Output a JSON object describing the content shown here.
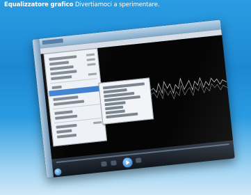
{
  "caption": {
    "line1_bold": "Equalizzatore grafico",
    "line1_text": "Divertiamoci a sperimentare."
  },
  "icons": {
    "start": "windows-orb-icon",
    "play": "play-icon",
    "previous": "previous-icon",
    "next": "next-icon",
    "stop": "stop-icon"
  },
  "colors": {
    "page_background": "#1f8ed6",
    "menu_highlight": "#3e7fd0",
    "waveform": "#bdbdbd"
  }
}
